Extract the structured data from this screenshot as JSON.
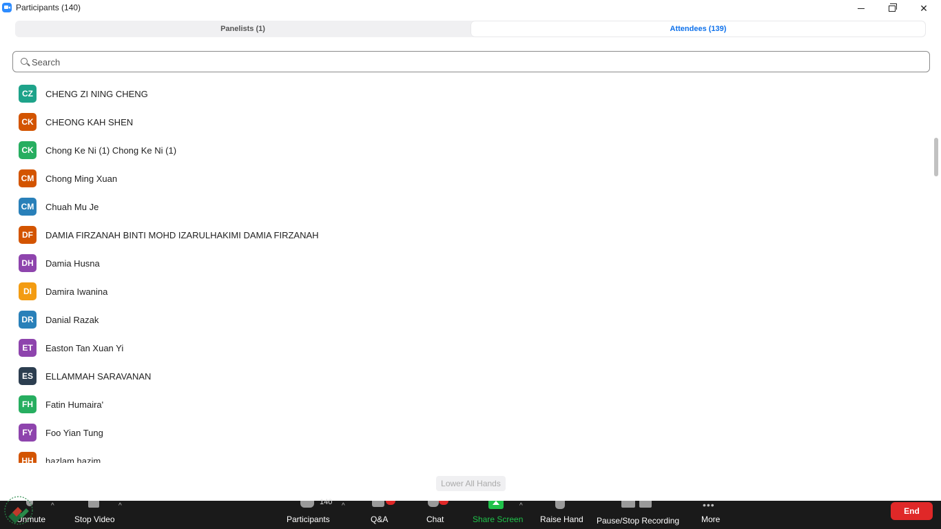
{
  "window": {
    "title": "Participants (140)"
  },
  "tabs": {
    "panelists": "Panelists (1)",
    "attendees": "Attendees (139)"
  },
  "search": {
    "placeholder": "Search"
  },
  "participants": [
    {
      "initials": "CZ",
      "name": "CHENG ZI NING CHENG",
      "color": "#1ea38a"
    },
    {
      "initials": "CK",
      "name": "CHEONG KAH SHEN",
      "color": "#d35400"
    },
    {
      "initials": "CK",
      "name": "Chong Ke Ni (1) Chong Ke Ni (1)",
      "color": "#27ae60"
    },
    {
      "initials": "CM",
      "name": "Chong Ming Xuan",
      "color": "#d35400"
    },
    {
      "initials": "CM",
      "name": "Chuah Mu Je",
      "color": "#2980b9"
    },
    {
      "initials": "DF",
      "name": "DAMIA FIRZANAH BINTI MOHD IZARULHAKIMI DAMIA FIRZANAH",
      "color": "#d35400"
    },
    {
      "initials": "DH",
      "name": "Damia Husna",
      "color": "#8e44ad"
    },
    {
      "initials": "DI",
      "name": "Damira Iwanina",
      "color": "#f39c12"
    },
    {
      "initials": "DR",
      "name": "Danial Razak",
      "color": "#2980b9"
    },
    {
      "initials": "ET",
      "name": "Easton Tan Xuan Yi",
      "color": "#8e44ad"
    },
    {
      "initials": "ES",
      "name": "ELLAMMAH SARAVANAN",
      "color": "#2c3e50"
    },
    {
      "initials": "FH",
      "name": "Fatin Humaira'",
      "color": "#27ae60"
    },
    {
      "initials": "FY",
      "name": "Foo Yian Tung",
      "color": "#8e44ad"
    },
    {
      "initials": "HH",
      "name": "hazlam hazim",
      "color": "#d35400"
    }
  ],
  "lower_all_hands": "Lower All Hands",
  "toolbar": {
    "unmute": "Unmute",
    "stop_video": "Stop Video",
    "participants": "Participants",
    "participants_count": "140",
    "qa": "Q&A",
    "chat": "Chat",
    "share_screen": "Share Screen",
    "raise_hand": "Raise Hand",
    "pause_stop_recording": "Pause/Stop Recording",
    "more": "More",
    "end": "End",
    "share_color": "#1fc24a"
  }
}
